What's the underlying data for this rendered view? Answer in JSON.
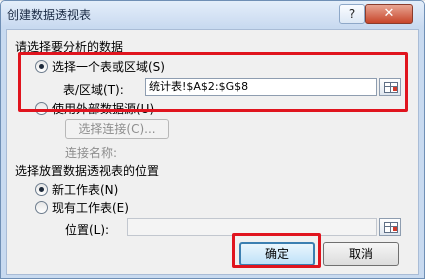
{
  "window": {
    "title": "创建数据透视表",
    "help_label": "?",
    "close_label": "✕"
  },
  "section_analyze": {
    "heading": "请选择要分析的数据",
    "option_range": "选择一个表或区域(S)",
    "range_label": "表/区域(T):",
    "range_value": "统计表!$A$2:$G$8",
    "option_external": "使用外部数据源(U)",
    "choose_connection": "选择连接(C)...",
    "connection_name_label": "连接名称:"
  },
  "section_place": {
    "heading": "选择放置数据透视表的位置",
    "option_new_sheet": "新工作表(N)",
    "option_existing_sheet": "现有工作表(E)",
    "location_label": "位置(L):",
    "location_value": ""
  },
  "buttons": {
    "ok": "确定",
    "cancel": "取消"
  },
  "colors": {
    "highlight": "#e0141e",
    "title_bar": "#c9daf0",
    "close_button": "#c7452a"
  }
}
